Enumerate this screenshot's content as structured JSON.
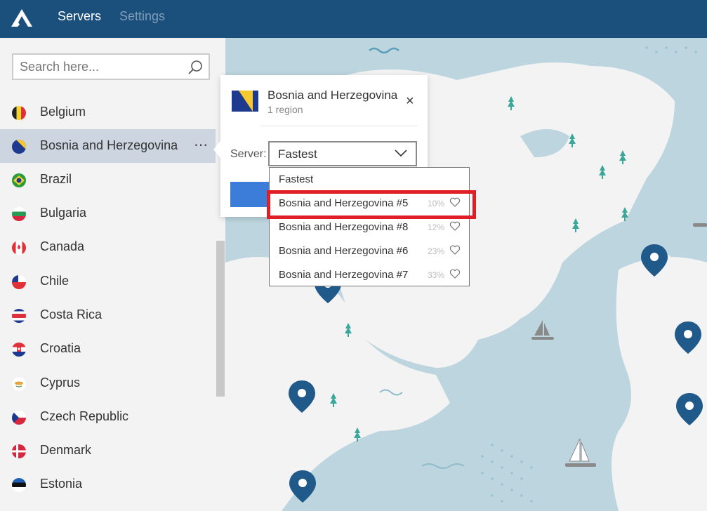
{
  "header": {
    "tabs": [
      {
        "label": "Servers",
        "active": true
      },
      {
        "label": "Settings",
        "active": false
      }
    ]
  },
  "search": {
    "placeholder": "Search here..."
  },
  "countries": [
    {
      "name": "Belgium",
      "flag": "belgium-flag"
    },
    {
      "name": "Bosnia and Herzegovina",
      "flag": "bosnia-flag",
      "selected": true,
      "more": "⋯"
    },
    {
      "name": "Brazil",
      "flag": "brazil-flag"
    },
    {
      "name": "Bulgaria",
      "flag": "bulgaria-flag"
    },
    {
      "name": "Canada",
      "flag": "canada-flag"
    },
    {
      "name": "Chile",
      "flag": "chile-flag"
    },
    {
      "name": "Costa Rica",
      "flag": "costa-rica-flag"
    },
    {
      "name": "Croatia",
      "flag": "croatia-flag"
    },
    {
      "name": "Cyprus",
      "flag": "cyprus-flag"
    },
    {
      "name": "Czech Republic",
      "flag": "czech-flag"
    },
    {
      "name": "Denmark",
      "flag": "denmark-flag"
    },
    {
      "name": "Estonia",
      "flag": "estonia-flag"
    }
  ],
  "popup": {
    "title": "Bosnia and Herzegovina",
    "subtitle": "1 region",
    "close": "×",
    "server_label": "Server:",
    "server_value": "Fastest"
  },
  "dropdown": {
    "options": [
      {
        "name": "Fastest",
        "load": ""
      },
      {
        "name": "Bosnia and Herzegovina #5",
        "load": "10%",
        "highlighted": true
      },
      {
        "name": "Bosnia and Herzegovina #8",
        "load": "12%"
      },
      {
        "name": "Bosnia and Herzegovina #6",
        "load": "23%"
      },
      {
        "name": "Bosnia and Herzegovina #7",
        "load": "33%"
      }
    ]
  },
  "colors": {
    "topbar": "#1b4f7c",
    "map_water": "#bcd5de",
    "land": "#f3f3f3",
    "pin": "#1f5a8a",
    "highlight": "#e01e25",
    "accent": "#3b7dd8"
  }
}
